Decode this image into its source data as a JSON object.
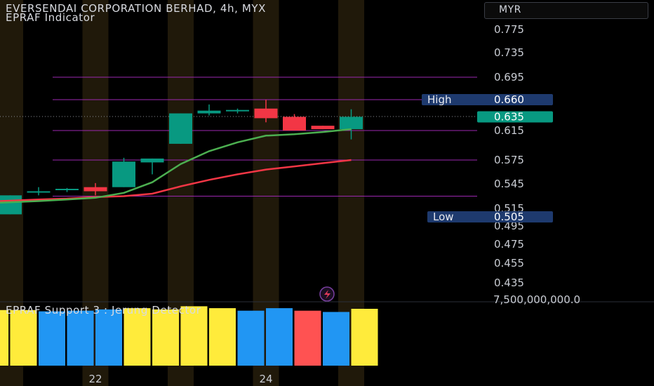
{
  "header": {
    "title": "EVERSENDAI CORPORATION BERHAD, 4h, MYX",
    "indicator": "EPRAF Indicator",
    "currency": "MYR"
  },
  "pane2": {
    "title": "EPRAF Support 3 : Jerung Detector",
    "axis_value": "7,500,000,000.0"
  },
  "colors": {
    "up": "#089981",
    "down": "#f23645",
    "ma_fast": "#4caf50",
    "ma_slow": "#f23645",
    "level_line": "#9c27b0",
    "highlight": "#f7c34c",
    "bar_yellow": "#ffeb3b",
    "bar_blue": "#2196f3",
    "bar_red": "#ff5252",
    "high_tag": "#1e3a6e",
    "last_tag": "#089981"
  },
  "chart_data": {
    "type": "candlestick",
    "price_axis_ticks": [
      "0.775",
      "0.735",
      "0.695",
      "0.660",
      "0.615",
      "0.575",
      "0.545",
      "0.515",
      "0.495",
      "0.475",
      "0.455",
      "0.435"
    ],
    "x_tick_labels": [
      {
        "label": "22",
        "index": 3
      },
      {
        "label": "24",
        "index": 9
      }
    ],
    "candles": [
      {
        "o": 0.508,
        "h": 0.531,
        "l": 0.508,
        "c": 0.531
      },
      {
        "o": 0.536,
        "h": 0.541,
        "l": 0.531,
        "c": 0.536
      },
      {
        "o": 0.539,
        "h": 0.54,
        "l": 0.535,
        "c": 0.539
      },
      {
        "o": 0.541,
        "h": 0.546,
        "l": 0.531,
        "c": 0.536
      },
      {
        "o": 0.541,
        "h": 0.578,
        "l": 0.541,
        "c": 0.573
      },
      {
        "o": 0.572,
        "h": 0.577,
        "l": 0.557,
        "c": 0.577
      },
      {
        "o": 0.597,
        "h": 0.64,
        "l": 0.597,
        "c": 0.64
      },
      {
        "o": 0.64,
        "h": 0.653,
        "l": 0.637,
        "c": 0.644
      },
      {
        "o": 0.644,
        "h": 0.647,
        "l": 0.64,
        "c": 0.645
      },
      {
        "o": 0.647,
        "h": 0.66,
        "l": 0.627,
        "c": 0.633
      },
      {
        "o": 0.635,
        "h": 0.639,
        "l": 0.615,
        "c": 0.615
      },
      {
        "o": 0.622,
        "h": 0.622,
        "l": 0.617,
        "c": 0.617
      },
      {
        "o": 0.617,
        "h": 0.646,
        "l": 0.603,
        "c": 0.635
      }
    ],
    "ma_fast": [
      0.522,
      0.524,
      0.526,
      0.528,
      0.534,
      0.547,
      0.57,
      0.587,
      0.599,
      0.608,
      0.61,
      0.613,
      0.617
    ],
    "ma_slow": [
      0.524,
      0.526,
      0.527,
      0.529,
      0.53,
      0.533,
      0.542,
      0.55,
      0.557,
      0.563,
      0.567,
      0.571,
      0.575
    ],
    "highlighted_bars": [
      0,
      3,
      6,
      9,
      12
    ],
    "levels": [
      0.695,
      0.66,
      0.615,
      0.575,
      0.53
    ],
    "high": {
      "label": "High",
      "value": "0.660"
    },
    "low": {
      "label": "Low",
      "value": "0.505"
    },
    "last_price": "0.635",
    "volume_bars": [
      {
        "value": 0.88,
        "color": "yellow"
      },
      {
        "value": 0.88,
        "color": "yellow"
      },
      {
        "value": 0.86,
        "color": "blue"
      },
      {
        "value": 0.87,
        "color": "blue"
      },
      {
        "value": 0.89,
        "color": "blue"
      },
      {
        "value": 0.91,
        "color": "yellow"
      },
      {
        "value": 0.89,
        "color": "yellow"
      },
      {
        "value": 0.94,
        "color": "yellow"
      },
      {
        "value": 0.91,
        "color": "yellow"
      },
      {
        "value": 0.87,
        "color": "blue"
      },
      {
        "value": 0.91,
        "color": "blue"
      },
      {
        "value": 0.87,
        "color": "red"
      },
      {
        "value": 0.85,
        "color": "blue"
      },
      {
        "value": 0.9,
        "color": "yellow"
      }
    ]
  }
}
